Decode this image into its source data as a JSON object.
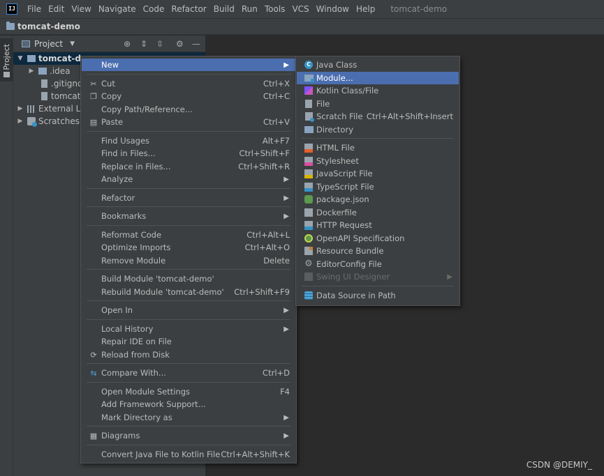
{
  "window": {
    "title": "tomcat-demo",
    "app_icon_text": "IJ"
  },
  "menubar": [
    "File",
    "Edit",
    "View",
    "Navigate",
    "Code",
    "Refactor",
    "Build",
    "Run",
    "Tools",
    "VCS",
    "Window",
    "Help"
  ],
  "breadcrumb": {
    "title": "tomcat-demo"
  },
  "toolstrip": {
    "project_label": "Project"
  },
  "project_panel": {
    "header": "Project",
    "tree": [
      {
        "label": "tomcat-demo",
        "level": 0
      },
      {
        "label": ".idea",
        "level": 1
      },
      {
        "label": ".gitignore",
        "level": 1
      },
      {
        "label": "tomcat-demo.iml",
        "level": 1
      },
      {
        "label": "External Libraries",
        "level": 0
      },
      {
        "label": "Scratches and Consoles",
        "level": 0
      }
    ]
  },
  "context_menu": {
    "items": [
      {
        "label": "New"
      },
      {
        "label": "Cut",
        "shortcut": "Ctrl+X"
      },
      {
        "label": "Copy",
        "shortcut": "Ctrl+C"
      },
      {
        "label": "Copy Path/Reference..."
      },
      {
        "label": "Paste",
        "shortcut": "Ctrl+V"
      },
      {
        "label": "Find Usages",
        "shortcut": "Alt+F7"
      },
      {
        "label": "Find in Files...",
        "shortcut": "Ctrl+Shift+F"
      },
      {
        "label": "Replace in Files...",
        "shortcut": "Ctrl+Shift+R"
      },
      {
        "label": "Analyze"
      },
      {
        "label": "Refactor"
      },
      {
        "label": "Bookmarks"
      },
      {
        "label": "Reformat Code",
        "shortcut": "Ctrl+Alt+L"
      },
      {
        "label": "Optimize Imports",
        "shortcut": "Ctrl+Alt+O"
      },
      {
        "label": "Remove Module",
        "shortcut": "Delete"
      },
      {
        "label": "Build Module 'tomcat-demo'"
      },
      {
        "label": "Rebuild Module 'tomcat-demo'",
        "shortcut": "Ctrl+Shift+F9"
      },
      {
        "label": "Open In"
      },
      {
        "label": "Local History"
      },
      {
        "label": "Repair IDE on File"
      },
      {
        "label": "Reload from Disk"
      },
      {
        "label": "Compare With...",
        "shortcut": "Ctrl+D"
      },
      {
        "label": "Open Module Settings",
        "shortcut": "F4"
      },
      {
        "label": "Add Framework Support..."
      },
      {
        "label": "Mark Directory as"
      },
      {
        "label": "Diagrams"
      },
      {
        "label": "Convert Java File to Kotlin File",
        "shortcut": "Ctrl+Alt+Shift+K"
      }
    ]
  },
  "new_submenu": {
    "items": [
      {
        "label": "Java Class"
      },
      {
        "label": "Module..."
      },
      {
        "label": "Kotlin Class/File"
      },
      {
        "label": "File"
      },
      {
        "label": "Scratch File",
        "shortcut": "Ctrl+Alt+Shift+Insert"
      },
      {
        "label": "Directory"
      },
      {
        "label": "HTML File"
      },
      {
        "label": "Stylesheet"
      },
      {
        "label": "JavaScript File"
      },
      {
        "label": "TypeScript File"
      },
      {
        "label": "package.json"
      },
      {
        "label": "Dockerfile"
      },
      {
        "label": "HTTP Request"
      },
      {
        "label": "OpenAPI Specification"
      },
      {
        "label": "Resource Bundle"
      },
      {
        "label": "EditorConfig File"
      },
      {
        "label": "Swing UI Designer"
      },
      {
        "label": "Data Source in Path"
      }
    ]
  },
  "watermark": "CSDN @DEMIY_",
  "colors": {
    "highlight": "#4b6eaf",
    "background": "#2b2b2b",
    "panel": "#3c3f41"
  }
}
